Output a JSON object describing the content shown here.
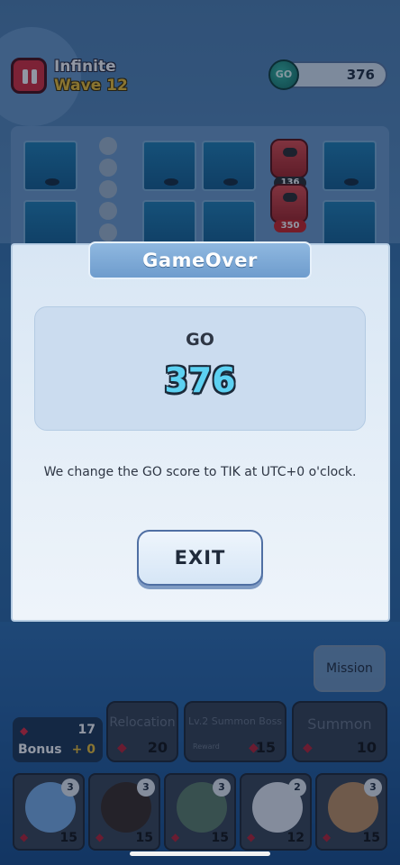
{
  "hud": {
    "mode": "Infinite",
    "wave": "Wave 12",
    "currency_icon": "GO",
    "currency_value": "376"
  },
  "board": {
    "enemies": [
      {
        "hp": "136"
      },
      {
        "hp": "350"
      }
    ]
  },
  "modal": {
    "title": "GameOver",
    "score_label": "GO",
    "score_value": "376",
    "notice": "We change the GO score to TIK at UTC+0 o'clock.",
    "exit_label": "EXIT"
  },
  "bottom": {
    "mission_label": "Mission",
    "gems": "17",
    "bonus_label": "Bonus",
    "bonus_value": "+ 0",
    "actions": [
      {
        "label": "Relocation",
        "cost": "20"
      },
      {
        "label": "Lv.2 Summon Boss",
        "sub": "Reward",
        "cost": "15"
      },
      {
        "label": "Summon",
        "cost": "10"
      }
    ],
    "units": [
      {
        "level": "3",
        "cost": "15",
        "color": "#7ab0e8"
      },
      {
        "level": "3",
        "cost": "15",
        "color": "#3a2a22"
      },
      {
        "level": "3",
        "cost": "15",
        "color": "#5e7e66"
      },
      {
        "level": "2",
        "cost": "12",
        "color": "#e7ecf3"
      },
      {
        "level": "3",
        "cost": "15",
        "color": "#c29060"
      }
    ]
  },
  "colors": {
    "accent": "#5cd1f2",
    "pause": "#d92a3a",
    "wave": "#f2c230"
  }
}
